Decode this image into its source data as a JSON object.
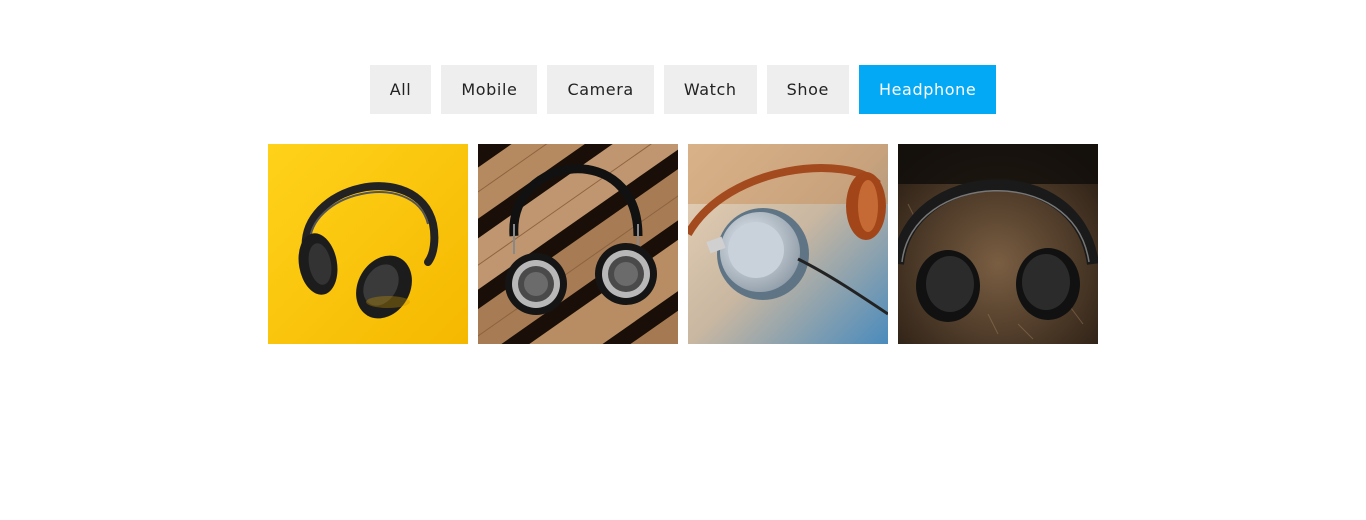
{
  "filters": {
    "items": [
      {
        "label": "All"
      },
      {
        "label": "Mobile"
      },
      {
        "label": "Camera"
      },
      {
        "label": "Watch"
      },
      {
        "label": "Shoe"
      },
      {
        "label": "Headphone"
      }
    ],
    "active_index": 5,
    "active_color": "#03a9f4",
    "inactive_color": "#eeeeee"
  },
  "gallery": {
    "items": [
      {
        "icon": "headphone-on-yellow-image"
      },
      {
        "icon": "headphone-on-wood-image"
      },
      {
        "icon": "headphone-silver-cup-image"
      },
      {
        "icon": "headphone-on-fur-image"
      }
    ]
  }
}
